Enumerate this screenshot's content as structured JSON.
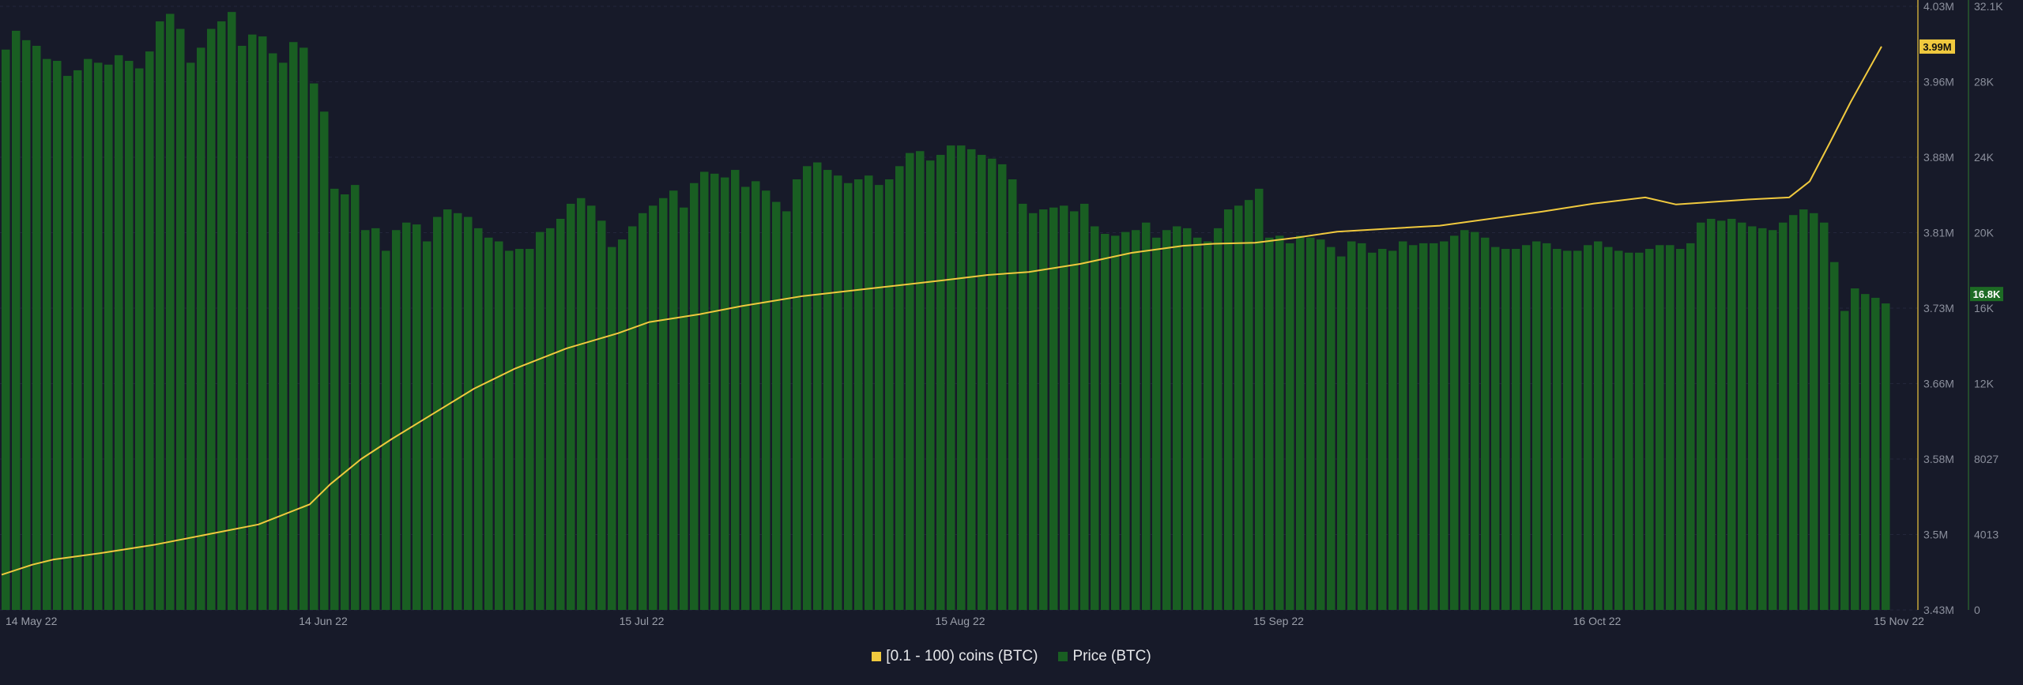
{
  "chart_data": {
    "type": "bar+line",
    "title": "",
    "x_labels": [
      "14 May 22",
      "14 Jun 22",
      "15 Jul 22",
      "15 Aug 22",
      "15 Sep 22",
      "16 Oct 22",
      "15 Nov 22"
    ],
    "x_label_days": [
      0,
      31,
      62,
      93,
      124,
      155,
      185
    ],
    "left_axis": {
      "ticks": [
        "4.03M",
        "3.96M",
        "3.88M",
        "3.81M",
        "3.73M",
        "3.66M",
        "3.58M",
        "3.5M",
        "3.43M"
      ],
      "min": 3430000,
      "max": 4030000,
      "current_label": "3.99M",
      "current_value": 3990000
    },
    "right_axis": {
      "ticks": [
        "32.1K",
        "28K",
        "24K",
        "20K",
        "16K",
        "12K",
        "8027",
        "4013",
        "0"
      ],
      "min": 0,
      "max": 32100,
      "current_label": "16.8K",
      "current_value": 16800
    },
    "series": [
      {
        "name": "[0.1 - 100) coins (BTC)",
        "type": "line",
        "axis": "left",
        "color": "#f0c93e",
        "points": [
          [
            0,
            3.465
          ],
          [
            3,
            3.475
          ],
          [
            5,
            3.48
          ],
          [
            10,
            3.487
          ],
          [
            15,
            3.495
          ],
          [
            20,
            3.505
          ],
          [
            25,
            3.515
          ],
          [
            30,
            3.535
          ],
          [
            32,
            3.555
          ],
          [
            35,
            3.58
          ],
          [
            38,
            3.6
          ],
          [
            42,
            3.625
          ],
          [
            46,
            3.65
          ],
          [
            50,
            3.67
          ],
          [
            55,
            3.69
          ],
          [
            60,
            3.705
          ],
          [
            63,
            3.716
          ],
          [
            68,
            3.724
          ],
          [
            72,
            3.732
          ],
          [
            78,
            3.742
          ],
          [
            85,
            3.75
          ],
          [
            92,
            3.758
          ],
          [
            96,
            3.763
          ],
          [
            100,
            3.766
          ],
          [
            105,
            3.774
          ],
          [
            110,
            3.785
          ],
          [
            115,
            3.792
          ],
          [
            118,
            3.794
          ],
          [
            122,
            3.795
          ],
          [
            126,
            3.8
          ],
          [
            130,
            3.806
          ],
          [
            140,
            3.812
          ],
          [
            150,
            3.826
          ],
          [
            155,
            3.834
          ],
          [
            160,
            3.84
          ],
          [
            163,
            3.833
          ],
          [
            170,
            3.838
          ],
          [
            174,
            3.84
          ],
          [
            176,
            3.856
          ],
          [
            178,
            3.895
          ],
          [
            180,
            3.935
          ],
          [
            183,
            3.99
          ]
        ]
      },
      {
        "name": "Price (BTC)",
        "type": "bar",
        "axis": "right",
        "color": "#195e22",
        "points": [
          [
            0,
            29800
          ],
          [
            1,
            30800
          ],
          [
            2,
            30300
          ],
          [
            3,
            30000
          ],
          [
            4,
            29300
          ],
          [
            5,
            29200
          ],
          [
            6,
            28400
          ],
          [
            7,
            28700
          ],
          [
            8,
            29300
          ],
          [
            9,
            29100
          ],
          [
            10,
            29000
          ],
          [
            11,
            29500
          ],
          [
            12,
            29200
          ],
          [
            13,
            28800
          ],
          [
            14,
            29700
          ],
          [
            15,
            31300
          ],
          [
            16,
            31700
          ],
          [
            17,
            30900
          ],
          [
            18,
            29100
          ],
          [
            19,
            29900
          ],
          [
            20,
            30900
          ],
          [
            21,
            31300
          ],
          [
            22,
            31800
          ],
          [
            23,
            30000
          ],
          [
            24,
            30600
          ],
          [
            25,
            30500
          ],
          [
            26,
            29600
          ],
          [
            27,
            29100
          ],
          [
            28,
            30200
          ],
          [
            29,
            29900
          ],
          [
            30,
            28000
          ],
          [
            31,
            26500
          ],
          [
            32,
            22400
          ],
          [
            33,
            22100
          ],
          [
            34,
            22600
          ],
          [
            35,
            20200
          ],
          [
            36,
            20300
          ],
          [
            37,
            19100
          ],
          [
            38,
            20200
          ],
          [
            39,
            20600
          ],
          [
            40,
            20500
          ],
          [
            41,
            19600
          ],
          [
            42,
            20900
          ],
          [
            43,
            21300
          ],
          [
            44,
            21100
          ],
          [
            45,
            20900
          ],
          [
            46,
            20300
          ],
          [
            47,
            19800
          ],
          [
            48,
            19600
          ],
          [
            49,
            19100
          ],
          [
            50,
            19200
          ],
          [
            51,
            19200
          ],
          [
            52,
            20100
          ],
          [
            53,
            20300
          ],
          [
            54,
            20800
          ],
          [
            55,
            21600
          ],
          [
            56,
            21900
          ],
          [
            57,
            21500
          ],
          [
            58,
            20700
          ],
          [
            59,
            19300
          ],
          [
            60,
            19700
          ],
          [
            61,
            20400
          ],
          [
            62,
            21100
          ],
          [
            63,
            21500
          ],
          [
            64,
            21900
          ],
          [
            65,
            22300
          ],
          [
            66,
            21400
          ],
          [
            67,
            22700
          ],
          [
            68,
            23300
          ],
          [
            69,
            23200
          ],
          [
            70,
            23000
          ],
          [
            71,
            23400
          ],
          [
            72,
            22500
          ],
          [
            73,
            22800
          ],
          [
            74,
            22300
          ],
          [
            75,
            21700
          ],
          [
            76,
            21200
          ],
          [
            77,
            22900
          ],
          [
            78,
            23600
          ],
          [
            79,
            23800
          ],
          [
            80,
            23400
          ],
          [
            81,
            23100
          ],
          [
            82,
            22700
          ],
          [
            83,
            22900
          ],
          [
            84,
            23100
          ],
          [
            85,
            22600
          ],
          [
            86,
            22900
          ],
          [
            87,
            23600
          ],
          [
            88,
            24300
          ],
          [
            89,
            24400
          ],
          [
            90,
            23900
          ],
          [
            91,
            24200
          ],
          [
            92,
            24700
          ],
          [
            93,
            24700
          ],
          [
            94,
            24500
          ],
          [
            95,
            24200
          ],
          [
            96,
            24000
          ],
          [
            97,
            23700
          ],
          [
            98,
            22900
          ],
          [
            99,
            21600
          ],
          [
            100,
            21100
          ],
          [
            101,
            21300
          ],
          [
            102,
            21400
          ],
          [
            103,
            21500
          ],
          [
            104,
            21200
          ],
          [
            105,
            21600
          ],
          [
            106,
            20400
          ],
          [
            107,
            20000
          ],
          [
            108,
            19900
          ],
          [
            109,
            20100
          ],
          [
            110,
            20200
          ],
          [
            111,
            20600
          ],
          [
            112,
            19800
          ],
          [
            113,
            20200
          ],
          [
            114,
            20400
          ],
          [
            115,
            20300
          ],
          [
            116,
            19800
          ],
          [
            117,
            19600
          ],
          [
            118,
            20300
          ],
          [
            119,
            21300
          ],
          [
            120,
            21500
          ],
          [
            121,
            21800
          ],
          [
            122,
            22400
          ],
          [
            123,
            19800
          ],
          [
            124,
            19900
          ],
          [
            125,
            19500
          ],
          [
            126,
            19900
          ],
          [
            127,
            19800
          ],
          [
            128,
            19700
          ],
          [
            129,
            19300
          ],
          [
            130,
            18800
          ],
          [
            131,
            19600
          ],
          [
            132,
            19500
          ],
          [
            133,
            19000
          ],
          [
            134,
            19200
          ],
          [
            135,
            19100
          ],
          [
            136,
            19600
          ],
          [
            137,
            19400
          ],
          [
            138,
            19500
          ],
          [
            139,
            19500
          ],
          [
            140,
            19600
          ],
          [
            141,
            19900
          ],
          [
            142,
            20200
          ],
          [
            143,
            20100
          ],
          [
            144,
            19800
          ],
          [
            145,
            19300
          ],
          [
            146,
            19200
          ],
          [
            147,
            19200
          ],
          [
            148,
            19400
          ],
          [
            149,
            19600
          ],
          [
            150,
            19500
          ],
          [
            151,
            19200
          ],
          [
            152,
            19100
          ],
          [
            153,
            19100
          ],
          [
            154,
            19400
          ],
          [
            155,
            19600
          ],
          [
            156,
            19300
          ],
          [
            157,
            19100
          ],
          [
            158,
            19000
          ],
          [
            159,
            19000
          ],
          [
            160,
            19200
          ],
          [
            161,
            19400
          ],
          [
            162,
            19400
          ],
          [
            163,
            19200
          ],
          [
            164,
            19500
          ],
          [
            165,
            20600
          ],
          [
            166,
            20800
          ],
          [
            167,
            20700
          ],
          [
            168,
            20800
          ],
          [
            169,
            20600
          ],
          [
            170,
            20400
          ],
          [
            171,
            20300
          ],
          [
            172,
            20200
          ],
          [
            173,
            20600
          ],
          [
            174,
            21000
          ],
          [
            175,
            21300
          ],
          [
            176,
            21100
          ],
          [
            177,
            20600
          ],
          [
            178,
            18500
          ],
          [
            179,
            15900
          ],
          [
            180,
            17100
          ],
          [
            181,
            16800
          ],
          [
            182,
            16600
          ],
          [
            183,
            16300
          ]
        ]
      }
    ],
    "legend": {
      "position": "bottom-center"
    },
    "grid": true
  },
  "legend": {
    "line_label": "[0.1 - 100) coins (BTC)",
    "line_color": "#f0c93e",
    "bar_label": "Price (BTC)",
    "bar_color": "#195e22"
  }
}
